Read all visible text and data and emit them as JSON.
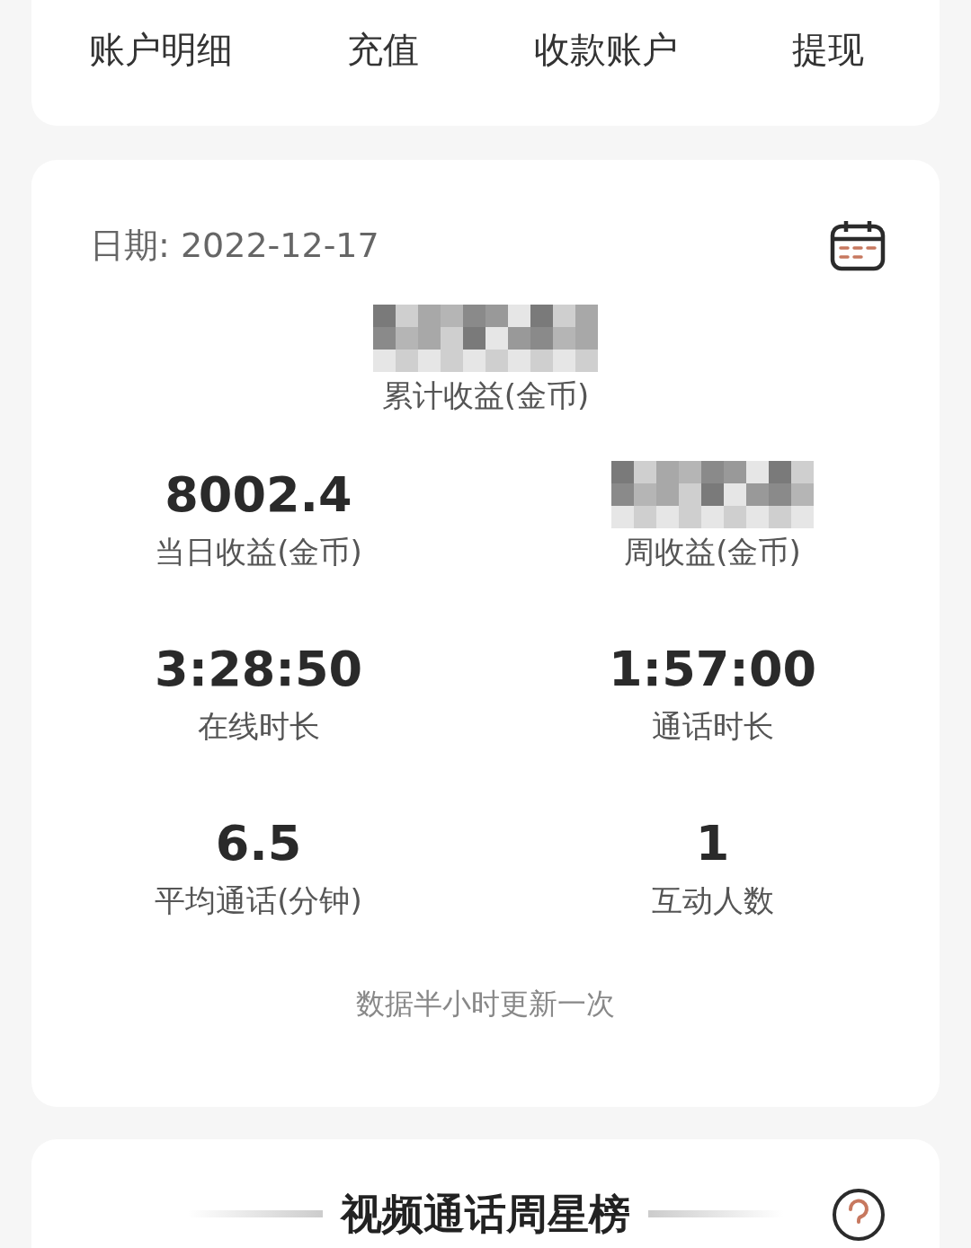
{
  "tabs": [
    {
      "label": "账户明细"
    },
    {
      "label": "充值"
    },
    {
      "label": "收款账户"
    },
    {
      "label": "提现"
    }
  ],
  "summary": {
    "date_label": "日期: 2022-12-17",
    "total": {
      "kind": "redacted",
      "label": "累计收益(金币)"
    },
    "stats": [
      {
        "kind": "value",
        "value": "8002.4",
        "label": "当日收益(金币)"
      },
      {
        "kind": "redacted",
        "label": "周收益(金币)"
      },
      {
        "kind": "value",
        "value": "3:28:50",
        "label": "在线时长"
      },
      {
        "kind": "value",
        "value": "1:57:00",
        "label": "通话时长"
      },
      {
        "kind": "value",
        "value": "6.5",
        "label": "平均通话(分钟)"
      },
      {
        "kind": "value",
        "value": "1",
        "label": "互动人数"
      }
    ],
    "note": "数据半小时更新一次"
  },
  "ranking": {
    "title": "视频通话周星榜"
  }
}
